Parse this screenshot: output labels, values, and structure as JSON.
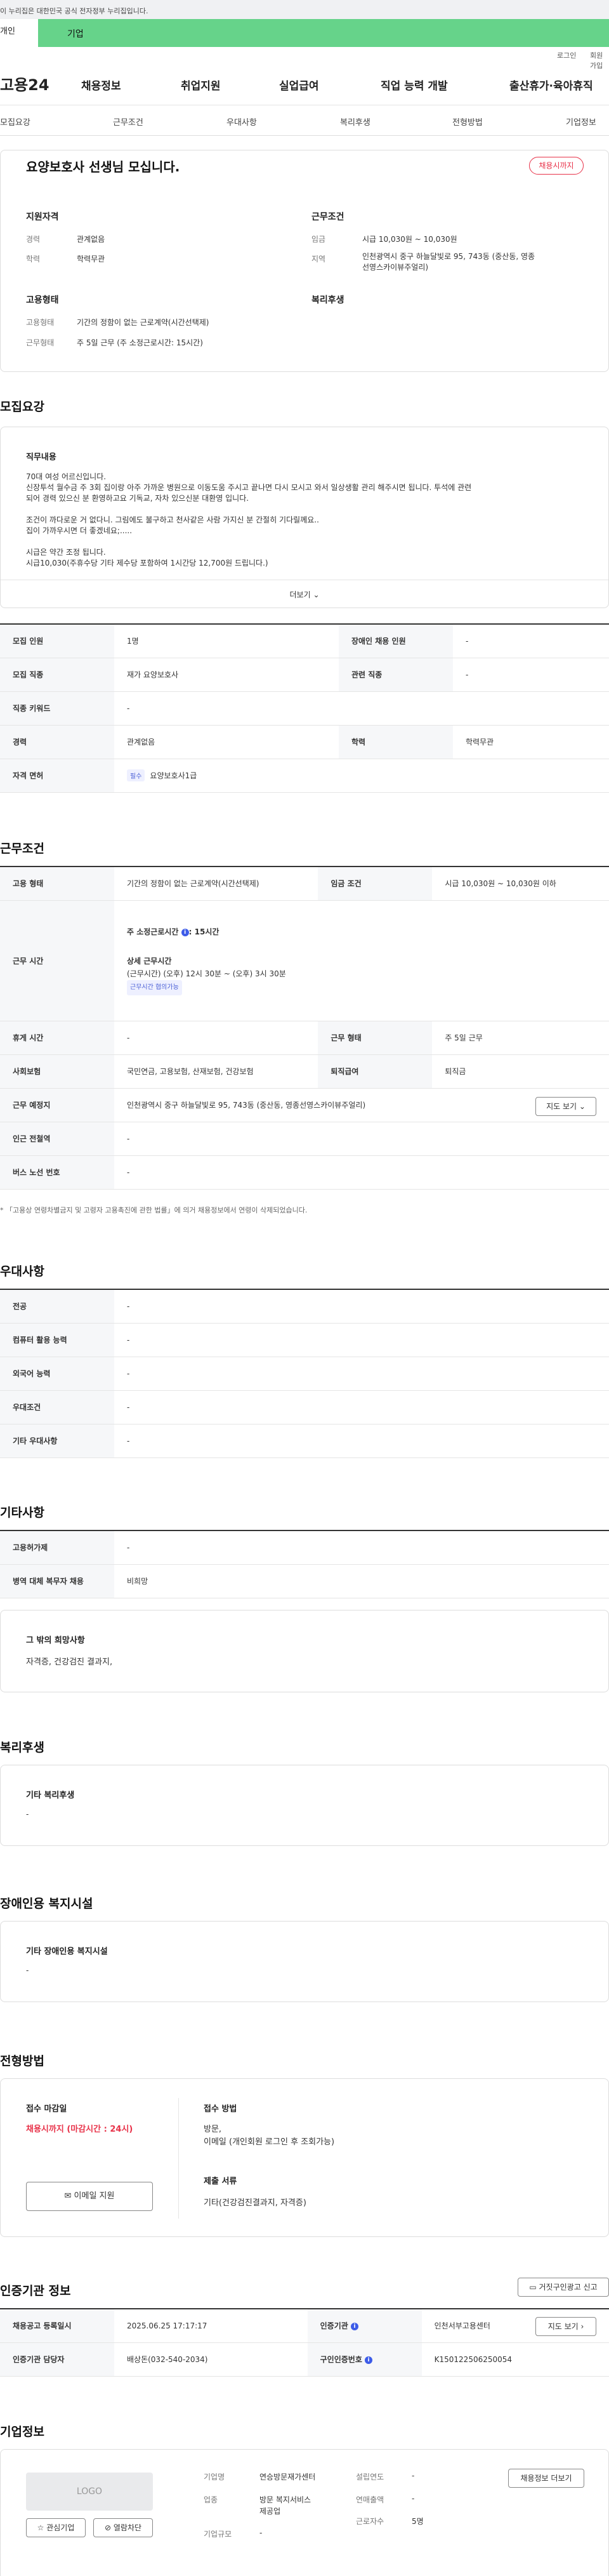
{
  "gov_banner": "이 누리집은 대한민국 공식 전자정부 누리집입니다.",
  "tabs": {
    "t1": "개인",
    "t2": "기업"
  },
  "util": {
    "login": "로그인",
    "join": "회원가입"
  },
  "gnb": {
    "logo": "고용24",
    "m1": "채용정보",
    "m2": "취업지원",
    "m3": "실업급여",
    "m4": "직업 능력 개발",
    "m5": "출산휴가·육아휴직"
  },
  "lnb": [
    "모집요강",
    "근무조건",
    "우대사항",
    "복리후생",
    "전형방법",
    "기업정보"
  ],
  "summary": {
    "title": "요양보호사 선생님 모십니다.",
    "status": "채용시까지",
    "h_qual": "지원자격",
    "h_cond": "근무조건",
    "h_emp": "고용형태",
    "h_welfare": "복리후생",
    "career_l": "경력",
    "career_v": "관계없음",
    "edu_l": "학력",
    "edu_v": "학력무관",
    "wage_l": "임금",
    "wage_v": "시급 10,030원 ~ 10,030원",
    "area_l": "지역",
    "area_v1": "인천광역시 중구 하늘달빛로 95, 743동 (중산동, 영종",
    "area_v2": "선영스카이뷰주얼리)",
    "emptype_l": "고용형태",
    "emptype_v": "기간의 정함이 없는 근로계약(시간선택제)",
    "worktype_l": "근무형태",
    "worktype_v": "주 5일 근무 (주 소정근로시간: 15시간)"
  },
  "recruit": {
    "heading": "모집요강",
    "duty_title": "직무내용",
    "duty_lines": [
      "70대 여성 어르신입니다.",
      "신장투석 월수금 주 3회 집이랑 아주 가까운 병원으로 이동도움 주시고 끝나면 다시 모시고 와서 일상생활 관리 해주시면 됩니다. 투석에 관련",
      "되어 경력 있으신 분 환영하고요 기독교, 자차 있으신분 대환영 입니다.",
      "",
      "조건이 까다로운 거 없다니. 그림에도 불구하고 천사같은 사람 가지신 분 간절히 기다릴께요..",
      "집이 가까우시면 더 좋겠네요;.....",
      "",
      "시급은 약간 조정 됩니다.",
      "시급10,030(주휴수당 기타 제수당 포함하여 1시간당 12,700원 드립니다.)"
    ],
    "more": "더보기",
    "rows": [
      [
        "모집 인원",
        "1명",
        "장애인 채용 인원",
        "-"
      ],
      [
        "모집 직종",
        "재가 요양보호사",
        "관련 직종",
        "-"
      ],
      [
        "직종 키워드",
        "-",
        "",
        ""
      ],
      [
        "경력",
        "관계없음",
        "학력",
        "학력무관"
      ],
      [
        "자격 면허",
        "요양보호사1급",
        "",
        ""
      ]
    ],
    "license_badge": "필수"
  },
  "work": {
    "heading": "근무조건",
    "r1": [
      "고용 형태",
      "기간의 정함이 없는 근로계약(시간선택제)",
      "임금 조건",
      "시급 10,030원 ~ 10,030원 이하"
    ],
    "hours_l": "근무 시간",
    "hours_week": "주 소정근로시간",
    "hours_week_v": ": 15시간",
    "detail_t": "상세 근무시간",
    "detail_v": "(근무시간) (오후) 12시 30분 ~ (오후) 3시 30분",
    "detail_badge": "근무시간 협의가능",
    "r3": [
      "휴게 시간",
      "-",
      "근무 형태",
      "주 5일 근무"
    ],
    "r4": [
      "사회보험",
      "국민연금, 고용보험, 산재보험, 건강보험",
      "퇴직급여",
      "퇴직금"
    ],
    "loc_l": "근무 예정지",
    "loc_v": "인천광역시 중구 하늘달빛로 95, 743동 (중산동, 영종선영스카이뷰주얼리)",
    "map_btn": "지도 보기",
    "r6": [
      "인근 전철역",
      "-"
    ],
    "r7": [
      "버스 노선 번호",
      "-"
    ],
    "note": "* 「고용상 연령차별금지 및 고령자 고용촉진에 관한 법률」에 의거 채용정보에서 연령이 삭제되었습니다."
  },
  "pref": {
    "heading": "우대사항",
    "rows": [
      [
        "전공",
        "-"
      ],
      [
        "컴퓨터 활용 능력",
        "-"
      ],
      [
        "외국어 능력",
        "-"
      ],
      [
        "우대조건",
        "-"
      ],
      [
        "기타 우대사항",
        "-"
      ]
    ]
  },
  "etc": {
    "heading": "기타사항",
    "rows": [
      [
        "고용허가제",
        "-"
      ],
      [
        "병역 대체 복무자 채용",
        "비희망"
      ]
    ],
    "wish_t": "그 밖의 희망사항",
    "wish_v": "자격증, 건강검진 결과지,"
  },
  "welfare": {
    "heading": "복리후생",
    "t": "기타 복리후생",
    "v": "-"
  },
  "disab": {
    "heading": "장애인용 복지시설",
    "t": "기타 장애인용 복지시설",
    "v": "-"
  },
  "process": {
    "heading": "전형방법",
    "deadline_t": "접수 마감일",
    "deadline_v": "채용시까지 (마감시간 : 24시)",
    "method_t": "접수 방법",
    "method_v1": "방문,",
    "method_v2": "이메일 (개인회원 로그인 후 조회가능)",
    "email_btn": "이메일 지원",
    "doc_t": "제출 서류",
    "doc_v": "기타(건강검진결과지, 자격증)"
  },
  "cert": {
    "heading": "인증기관 정보",
    "report_btn": "거짓구인광고 신고",
    "rows": [
      [
        "채용공고 등록일시",
        "2025.06.25 17:17:17",
        "인증기관",
        "인천서부고용센터"
      ],
      [
        "인증기관 담당자",
        "배상돈(032-540-2034)",
        "구인인증번호",
        "K150122506250054"
      ]
    ],
    "map_btn": "지도 보기"
  },
  "company": {
    "heading": "기업정보",
    "logo": "LOGO",
    "fav": "관심기업",
    "block": "열람차단",
    "name_l": "기업명",
    "name_v": "연승방문재가센터",
    "ind_l": "업종",
    "ind_v1": "방문 복지서비스",
    "ind_v2": "제공업",
    "size_l": "기업규모",
    "size_v": "-",
    "year_l": "설립연도",
    "year_v": "-",
    "sales_l": "연매출액",
    "sales_v": "-",
    "emp_l": "근로자수",
    "emp_v": "5명",
    "jobs_btn": "채용정보 더보기"
  }
}
